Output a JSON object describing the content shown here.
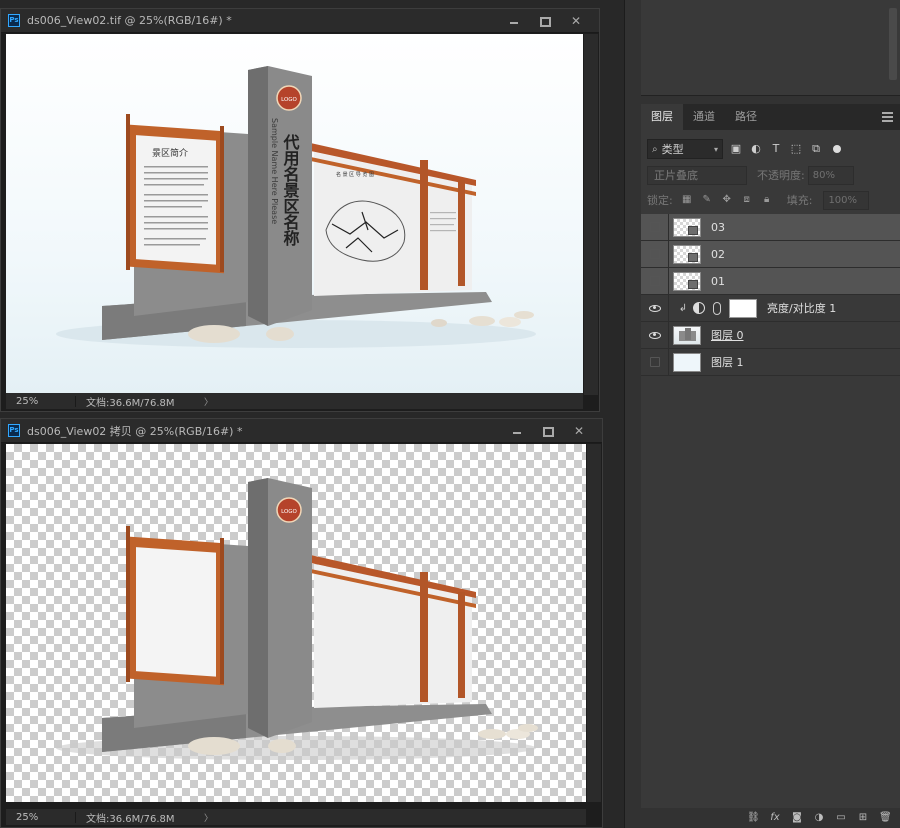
{
  "windows": [
    {
      "title": "ds006_View02.tif @ 25%(RGB/16#) *",
      "zoom": "25%",
      "doc_info": "文档:36.6M/76.8M",
      "sign_text": {
        "vertical_title": "代用名景区名称",
        "subtitle": "Sample Name Here Please",
        "left_board_title": "景区简介",
        "map_title": "名 景 区 导 览 图",
        "logo_text": "LOGO"
      }
    },
    {
      "title": "ds006_View02 拷贝 @ 25%(RGB/16#) *",
      "zoom": "25%",
      "doc_info": "文档:36.6M/76.8M",
      "sign_text": {
        "logo_text": "LOGO"
      }
    }
  ],
  "panel": {
    "tabs": [
      "图层",
      "通道",
      "路径"
    ],
    "active_tab": "图层",
    "filter_kind": "类型",
    "blend_mode": "正片叠底",
    "opacity_label": "不透明度:",
    "opacity_value": "80%",
    "lock_label": "锁定:",
    "fill_label": "填充:",
    "fill_value": "100%",
    "layers": [
      {
        "name": "03",
        "visible": false,
        "selected": true,
        "thumb": "transparent"
      },
      {
        "name": "02",
        "visible": false,
        "selected": true,
        "thumb": "transparent"
      },
      {
        "name": "01",
        "visible": false,
        "selected": true,
        "thumb": "transparent"
      },
      {
        "name": "亮度/对比度 1",
        "visible": true,
        "selected": false,
        "thumb": "adjustment"
      },
      {
        "name": "图层 0",
        "visible": true,
        "selected": false,
        "thumb": "sign"
      },
      {
        "name": "图层 1",
        "visible": false,
        "selected": false,
        "thumb": "white"
      }
    ]
  },
  "icons": {
    "ps_app": "photoshop-icon",
    "eye": "eye-icon",
    "footer": [
      "link-icon",
      "fx-icon",
      "mask-icon",
      "adjustment-icon",
      "folder-icon",
      "new-layer-icon",
      "trash-icon"
    ]
  }
}
